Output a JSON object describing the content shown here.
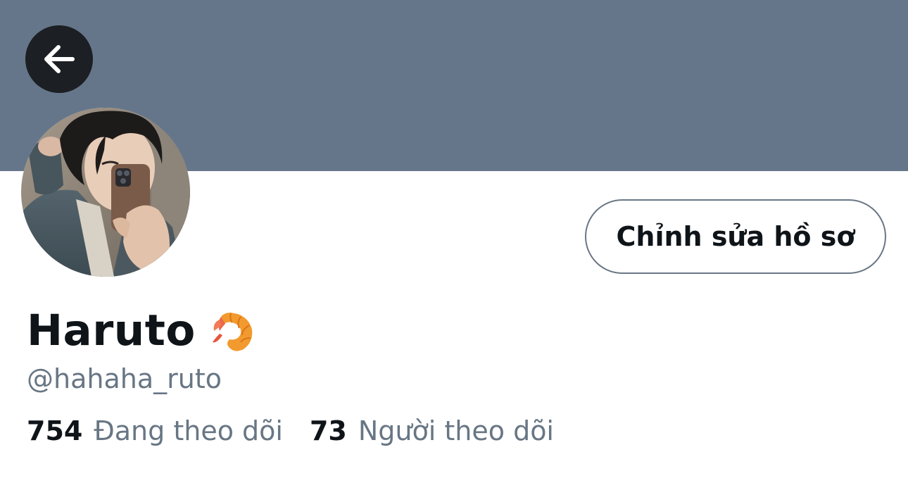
{
  "profile": {
    "display_name": "Haruto",
    "name_emoji": "shrimp-emoji",
    "handle": "@hahaha_ruto",
    "edit_button_label": "Chỉnh sửa hồ sơ"
  },
  "stats": {
    "following_count": "754",
    "following_label": "Đang theo dõi",
    "followers_count": "73",
    "followers_label": "Người theo dõi"
  },
  "icons": {
    "back": "arrow-left-icon"
  },
  "colors": {
    "banner": "#66768a",
    "back_button_bg": "#1c1f23",
    "primary_text": "#0f1419",
    "secondary_text": "#687684",
    "button_border": "#6a7785"
  }
}
